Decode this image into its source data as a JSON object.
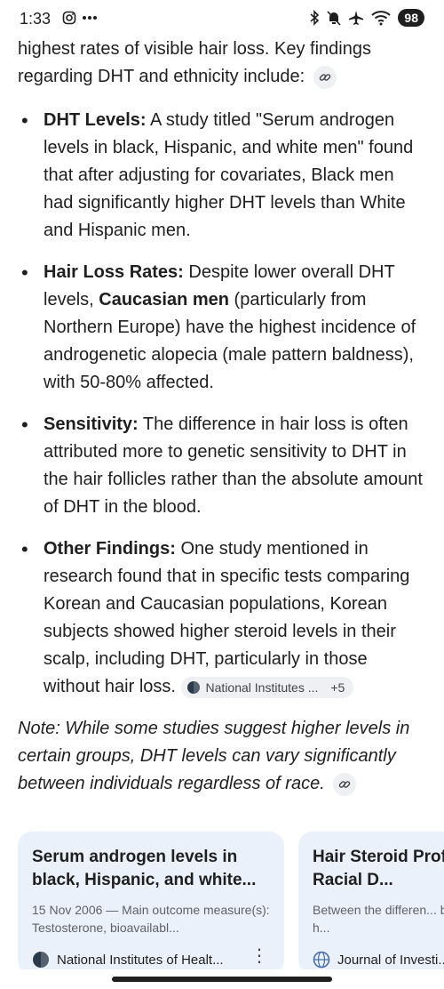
{
  "status_bar": {
    "time": "1:33",
    "battery": "98"
  },
  "content": {
    "intro": "highest rates of visible hair loss. Key findings regarding DHT and ethnicity include:",
    "findings": [
      {
        "title": "DHT Levels:",
        "text": " A study titled \"Serum androgen levels in black, Hispanic, and white men\" found that after adjusting for covariates, Black men had significantly higher DHT levels than White and Hispanic men."
      },
      {
        "title": "Hair Loss Rates:",
        "text_a": " Despite lower overall DHT levels, ",
        "bold_mid": "Caucasian men",
        "text_b": " (particularly from Northern Europe) have the highest incidence of androgenetic alopecia (male pattern baldness), with 50-80% affected."
      },
      {
        "title": "Sensitivity:",
        "text": " The difference in hair loss is often attributed more to genetic sensitivity to DHT in the hair follicles rather than the absolute amount of DHT in the blood."
      },
      {
        "title": "Other Findings:",
        "text": " One study mentioned in research found that in specific tests comparing Korean and Caucasian populations, Korean subjects showed higher steroid levels in their scalp, including DHT, particularly in those without hair loss.",
        "source_label": "National Institutes ...",
        "source_more": "+5"
      }
    ],
    "note": "Note: While some studies suggest higher levels in certain groups, DHT levels can vary significantly between individuals regardless of race."
  },
  "cards": [
    {
      "title": "Serum androgen levels in black, Hispanic, and white...",
      "snippet": "15 Nov 2006 — Main outcome measure(s): Testosterone, bioavailabl...",
      "source": "National Institutes of Healt..."
    },
    {
      "title": "Hair Steroid Profiles Reveals Racial D...",
      "snippet": "Between the differen... both Korean groups h...",
      "source": "Journal of Investi..."
    }
  ],
  "colors": {
    "card_bg": "#eaf1fb",
    "chip_bg": "#eef0f3",
    "text": "#1f1f1f",
    "muted": "#5f6368"
  }
}
